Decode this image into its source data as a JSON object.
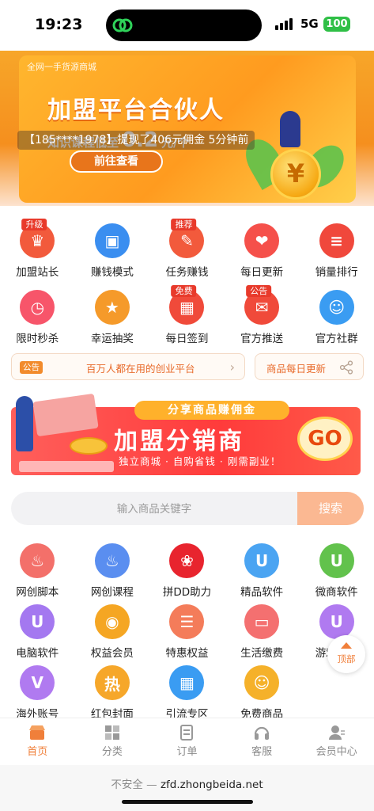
{
  "status_bar": {
    "time": "19:23",
    "network": "5G",
    "battery": "100"
  },
  "banner": {
    "small_caption": "全网一手货源商城",
    "title": "加盟平台合伙人",
    "subtitle_prefix": "知识课程低至",
    "subtitle_value": "0.2",
    "subtitle_suffix": "元/个",
    "cta": "前往查看",
    "coin_symbol": "¥",
    "ticker": "【185****1978】提现了406元佣金 5分钟前"
  },
  "menu_row1": [
    {
      "label": "加盟站长",
      "tag": "升级",
      "icon": "crown-icon",
      "color": "#f25a3c"
    },
    {
      "label": "赚钱模式",
      "tag": "",
      "icon": "monitor-icon",
      "color": "#3a8ef0"
    },
    {
      "label": "任务赚钱",
      "tag": "推荐",
      "icon": "task-icon",
      "color": "#f25a3c"
    },
    {
      "label": "每日更新",
      "tag": "",
      "icon": "gift-icon",
      "color": "#f5504a"
    },
    {
      "label": "销量排行",
      "tag": "",
      "icon": "rank-icon",
      "color": "#f0483c"
    }
  ],
  "menu_row2": [
    {
      "label": "限时秒杀",
      "tag": "",
      "icon": "alarm-icon",
      "color": "#f7556a"
    },
    {
      "label": "幸运抽奖",
      "tag": "",
      "icon": "lottery-icon",
      "color": "#f59a2a"
    },
    {
      "label": "每日签到",
      "tag": "免费",
      "icon": "calendar-icon",
      "color": "#f04a3a"
    },
    {
      "label": "官方推送",
      "tag": "公告",
      "icon": "message-icon",
      "color": "#f04a3a"
    },
    {
      "label": "官方社群",
      "tag": "",
      "icon": "chat-icon",
      "color": "#3a9cf2"
    }
  ],
  "notice": {
    "badge": "公告",
    "text": "百万人都在用的创业平台",
    "chevron": "›",
    "daily": "商品每日更新"
  },
  "promo": {
    "ribbon": "分享商品赚佣金",
    "headline": "加盟分销商",
    "subline": "独立商城 · 自购省钱 · 刚需副业！",
    "go": "GO"
  },
  "search": {
    "placeholder": "输入商品关键字",
    "value": "",
    "button": "搜索"
  },
  "categories_row1": [
    {
      "label": "网创脚本",
      "icon": "flame-icon",
      "color": "#f3706a"
    },
    {
      "label": "网创课程",
      "icon": "flame-icon",
      "color": "#5a8ef0"
    },
    {
      "label": "拼DD助力",
      "icon": "pdd-icon",
      "color": "#e8242e"
    },
    {
      "label": "精品软件",
      "icon": "u-icon",
      "color": "#4aa4f2"
    },
    {
      "label": "微商软件",
      "icon": "u-icon",
      "color": "#62c24c"
    }
  ],
  "categories_row2": [
    {
      "label": "电脑软件",
      "icon": "u-icon",
      "color": "#a478f0"
    },
    {
      "label": "权益会员",
      "icon": "coins-icon",
      "color": "#f5a623"
    },
    {
      "label": "特惠权益",
      "icon": "menu-icon",
      "color": "#f47c5a"
    },
    {
      "label": "生活缴费",
      "icon": "card-icon",
      "color": "#f47070"
    },
    {
      "label": "游戏专区",
      "icon": "u-icon",
      "color": "#b07af0"
    }
  ],
  "categories_row3": [
    {
      "label": "海外账号",
      "icon": "vip-icon",
      "color": "#b07af0"
    },
    {
      "label": "红包封面",
      "icon": "hot-icon",
      "color": "#f6a72a"
    },
    {
      "label": "引流专区",
      "icon": "grid-icon",
      "color": "#3a9cf2"
    },
    {
      "label": "免费商品",
      "icon": "free-icon",
      "color": "#f5b12a"
    }
  ],
  "back_to_top": "顶部",
  "tabbar": [
    {
      "label": "首页",
      "icon": "shop-icon",
      "active": true
    },
    {
      "label": "分类",
      "icon": "category-icon",
      "active": false
    },
    {
      "label": "订单",
      "icon": "order-icon",
      "active": false
    },
    {
      "label": "客服",
      "icon": "headset-icon",
      "active": false
    },
    {
      "label": "会员中心",
      "icon": "member-icon",
      "active": false
    }
  ],
  "url_bar": {
    "insecure": "不安全",
    "sep": " — ",
    "host": "zfd.zhongbeida.net"
  }
}
